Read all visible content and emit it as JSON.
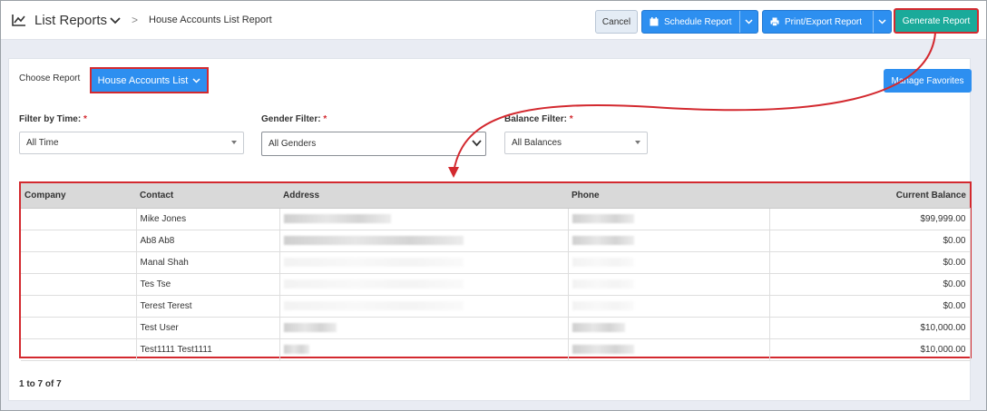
{
  "header": {
    "title": "List Reports",
    "breadcrumb_sep": ">",
    "breadcrumb": "House Accounts List Report",
    "cancel_label": "Cancel",
    "schedule_label": "Schedule Report",
    "print_label": "Print/Export Report",
    "generate_label": "Generate Report"
  },
  "report": {
    "choose_label": "Choose Report",
    "selected_report": "House Accounts List",
    "favorites_label": "Manage Favorites"
  },
  "filters": {
    "time": {
      "label": "Filter by Time:",
      "required": "*",
      "value": "All Time"
    },
    "gender": {
      "label": "Gender Filter:",
      "required": "*",
      "value": "All Genders"
    },
    "balance": {
      "label": "Balance Filter:",
      "required": "*",
      "value": "All Balances"
    }
  },
  "table": {
    "columns": [
      "Company",
      "Contact",
      "Address",
      "Phone",
      "Current Balance"
    ],
    "rows": [
      {
        "company": "",
        "contact": "Mike Jones",
        "balance": "$99,999.00"
      },
      {
        "company": "",
        "contact": "Ab8 Ab8",
        "balance": "$0.00"
      },
      {
        "company": "",
        "contact": "Manal Shah",
        "balance": "$0.00"
      },
      {
        "company": "",
        "contact": "Tes Tse",
        "balance": "$0.00"
      },
      {
        "company": "",
        "contact": "Terest Terest",
        "balance": "$0.00"
      },
      {
        "company": "",
        "contact": "Test User",
        "balance": "$10,000.00"
      },
      {
        "company": "",
        "contact": "Test1111 Test1111",
        "balance": "$10,000.00"
      }
    ]
  },
  "pager": {
    "text": "1 to 7 of 7"
  },
  "colors": {
    "primary": "#2d8ff0",
    "generate": "#1aaa9a",
    "highlight": "#d3292f"
  }
}
